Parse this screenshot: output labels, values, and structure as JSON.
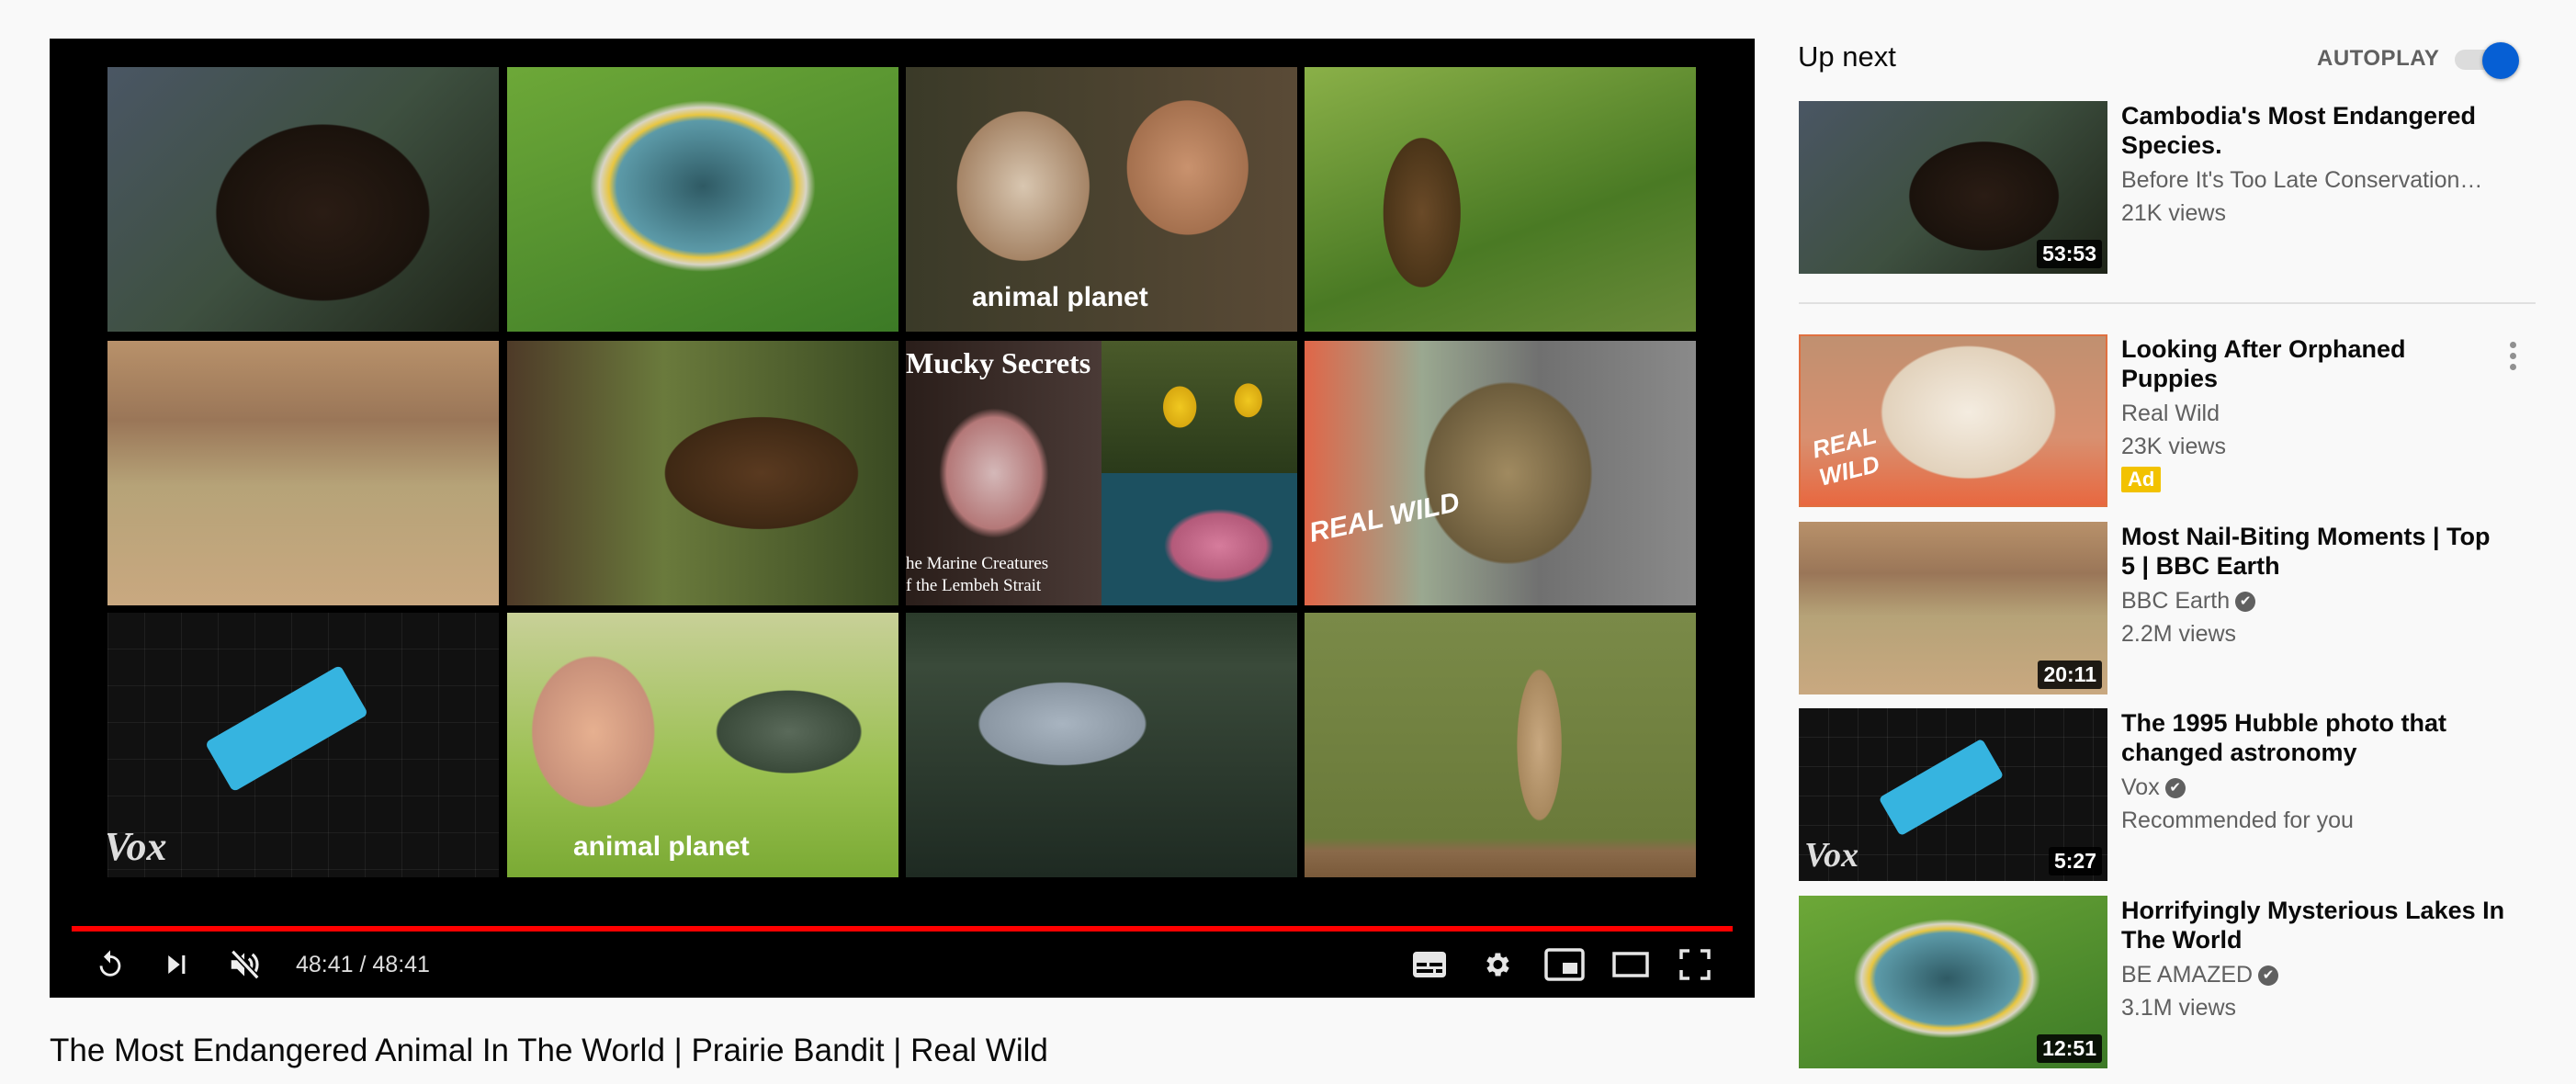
{
  "theme": {
    "accent": "#ff0000",
    "toggle": "#065fd4",
    "ad_badge": "#f2c200"
  },
  "player": {
    "end_screen": [
      {
        "subject": "sun bear"
      },
      {
        "subject": "crater lake",
        "overlay": ""
      },
      {
        "subject": "slow loris with presenter",
        "overlay": "animal planet"
      },
      {
        "subject": "tribesman with bow"
      },
      {
        "subject": "cheetah chasing antelope"
      },
      {
        "subject": "brown bears",
        "overlay": ""
      },
      {
        "subject": "pygmy seahorse and fish",
        "overlay": "Mucky Secrets",
        "overlay2": "he Marine Creatures",
        "overlay3": "f the Lembeh Strait"
      },
      {
        "subject": "margay cat",
        "overlay": "REAL WILD"
      },
      {
        "subject": "hubble telescope",
        "overlay": "Vox"
      },
      {
        "subject": "boy with crocodile",
        "overlay": "animal planet"
      },
      {
        "subject": "hippo in water"
      },
      {
        "subject": "prairie dog"
      }
    ],
    "progress_percent": 100,
    "time_current": "48:41",
    "time_separator": " / ",
    "time_total": "48:41",
    "time_display": "48:41 / 48:41",
    "controls": {
      "replay": "replay-icon",
      "next": "next-icon",
      "mute": "volume-muted-icon",
      "captions": "captions-icon",
      "settings": "gear-icon",
      "miniplayer": "miniplayer-icon",
      "theater": "theater-mode-icon",
      "fullscreen": "fullscreen-icon"
    }
  },
  "video": {
    "title": "The Most Endangered Animal In The World | Prairie Bandit | Real Wild"
  },
  "sidebar": {
    "up_next_label": "Up next",
    "autoplay_label": "AUTOPLAY",
    "autoplay_on": true,
    "items": [
      {
        "title": "Cambodia's Most Endangered Species.",
        "channel": "Before It's Too Late Conservation…",
        "verified": false,
        "meta": "21K views",
        "duration": "53:53"
      },
      {
        "title": "Looking After Orphaned Puppies",
        "channel": "Real Wild",
        "verified": false,
        "meta": "23K views",
        "badge": "Ad",
        "duration": ""
      },
      {
        "title": "Most Nail-Biting Moments | Top 5 | BBC Earth",
        "channel": "BBC Earth",
        "verified": true,
        "meta": "2.2M views",
        "duration": "20:11"
      },
      {
        "title": "The 1995 Hubble photo that changed astronomy",
        "channel": "Vox",
        "verified": true,
        "meta": "Recommended for you",
        "duration": "5:27"
      },
      {
        "title": "Horrifyingly Mysterious Lakes In The World",
        "channel": "BE AMAZED",
        "verified": true,
        "meta": "3.1M views",
        "duration": "12:51"
      }
    ],
    "verified_glyph": "✔"
  }
}
